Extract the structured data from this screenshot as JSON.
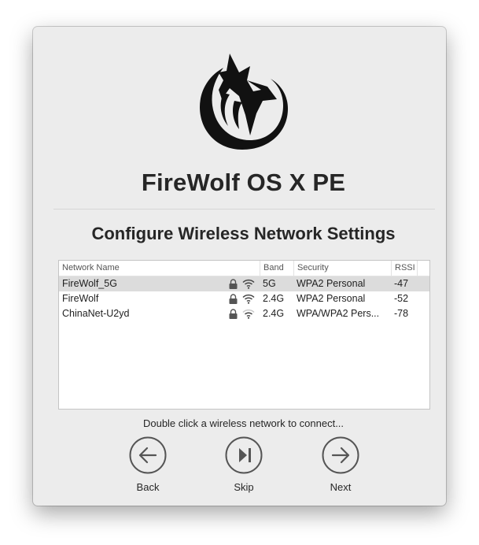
{
  "app": {
    "title": "FireWolf OS X PE"
  },
  "page": {
    "heading": "Configure Wireless Network Settings",
    "hint": "Double click a wireless network to connect..."
  },
  "table": {
    "columns": {
      "name": "Network Name",
      "band": "Band",
      "security": "Security",
      "rssi": "RSSI"
    },
    "rows": [
      {
        "name": "FireWolf_5G",
        "band": "5G",
        "security": "WPA2 Personal",
        "rssi": "-47",
        "secured": true,
        "signal": 3,
        "selected": true
      },
      {
        "name": "FireWolf",
        "band": "2.4G",
        "security": "WPA2 Personal",
        "rssi": "-52",
        "secured": true,
        "signal": 3,
        "selected": false
      },
      {
        "name": "ChinaNet-U2yd",
        "band": "2.4G",
        "security": "WPA/WPA2 Pers...",
        "rssi": "-78",
        "secured": true,
        "signal": 2,
        "selected": false
      }
    ]
  },
  "nav": {
    "back": "Back",
    "skip": "Skip",
    "next": "Next"
  },
  "icons": {
    "logo": "wolf-logo-icon",
    "lock": "lock-icon",
    "wifi": "wifi-icon",
    "back": "arrow-left-circle-icon",
    "skip": "skip-forward-circle-icon",
    "next": "arrow-right-circle-icon"
  },
  "colors": {
    "window_bg": "#ececec",
    "selected_row": "#dcdcdc",
    "text": "#262626",
    "icon": "#555555"
  }
}
